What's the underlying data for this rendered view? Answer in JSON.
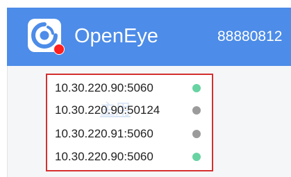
{
  "header": {
    "app_name": "OpenEye",
    "account_id": "88880812",
    "logo_icon": "openeye-logo-icon",
    "notification_color": "#ff1f1f",
    "background_color": "#4d8ce8"
  },
  "server_list": {
    "watermark": "主用",
    "items": [
      {
        "address": "10.30.220.90:5060",
        "status": "online",
        "status_color": "#68d3a2"
      },
      {
        "address": "10.30.220.90:50124",
        "status": "offline",
        "status_color": "#9b9b9b"
      },
      {
        "address": "10.30.220.91:5060",
        "status": "offline",
        "status_color": "#9b9b9b"
      },
      {
        "address": "10.30.220.90:5060",
        "status": "online",
        "status_color": "#68d3a2"
      }
    ]
  }
}
